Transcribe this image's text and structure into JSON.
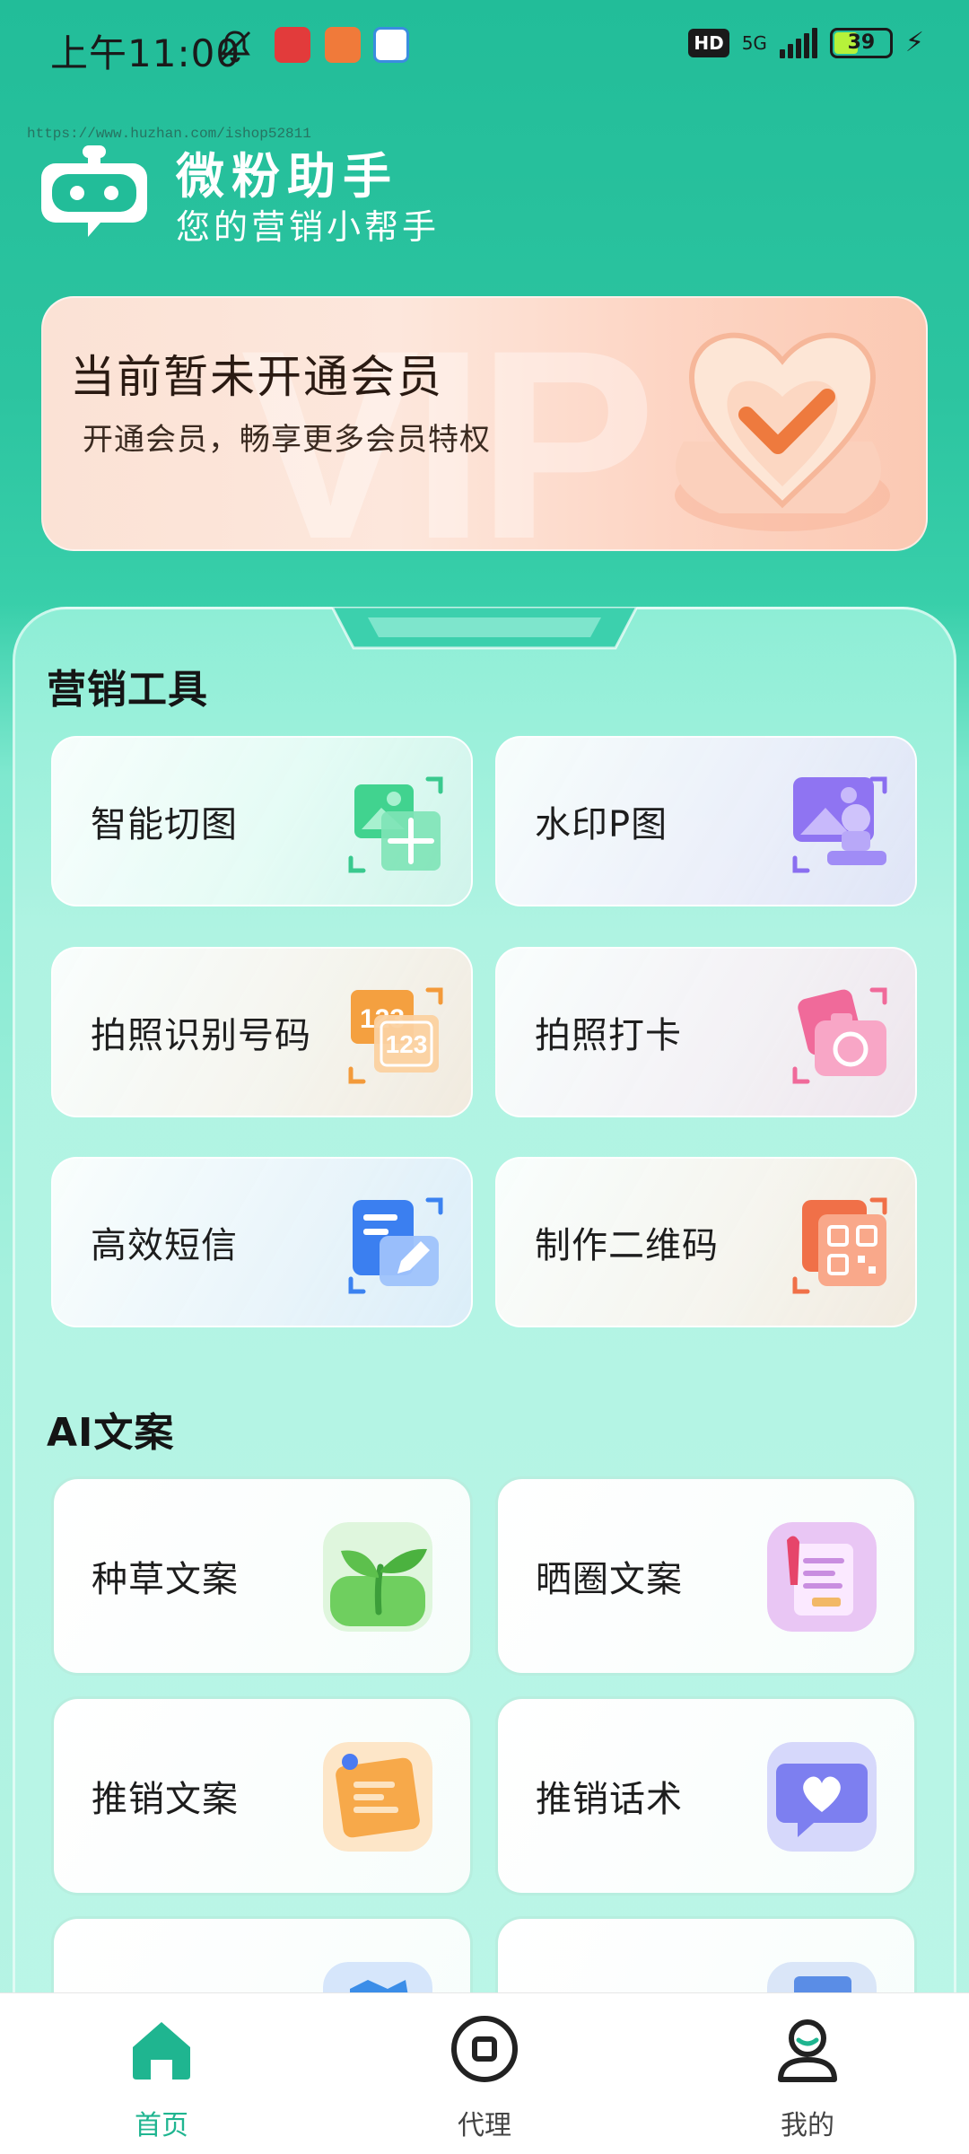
{
  "status_bar": {
    "time": "上午11:00",
    "hd": "HD",
    "network": "5G",
    "battery": "39"
  },
  "header": {
    "watermark": "https://www.huzhan.com/ishop52811",
    "title": "微粉助手",
    "subtitle": "您的营销小帮手"
  },
  "vip_banner": {
    "title": "当前暂未开通会员",
    "desc": "开通会员，畅享更多会员特权",
    "ghost_text": "VIP"
  },
  "marketing_tools": {
    "title": "营销工具",
    "items": [
      {
        "label": "智能切图",
        "icon": "image-crop-icon"
      },
      {
        "label": "水印P图",
        "icon": "watermark-stamp-icon"
      },
      {
        "label": "拍照识别号码",
        "icon": "number-scan-icon"
      },
      {
        "label": "拍照打卡",
        "icon": "camera-checkin-icon"
      },
      {
        "label": "高效短信",
        "icon": "sms-edit-icon"
      },
      {
        "label": "制作二维码",
        "icon": "qr-code-icon"
      }
    ]
  },
  "ai_copy": {
    "title": "AI文案",
    "items": [
      {
        "label": "种草文案",
        "icon": "sprout-icon"
      },
      {
        "label": "晒圈文案",
        "icon": "clipboard-pen-icon"
      },
      {
        "label": "推销文案",
        "icon": "sticky-note-icon"
      },
      {
        "label": "推销话术",
        "icon": "heart-chat-icon"
      },
      {
        "label": "",
        "icon": "badge-icon"
      },
      {
        "label": "",
        "icon": "document-icon"
      }
    ]
  },
  "bottom_nav": {
    "items": [
      {
        "label": "首页",
        "icon": "home-icon",
        "active": true
      },
      {
        "label": "代理",
        "icon": "agent-icon",
        "active": false
      },
      {
        "label": "我的",
        "icon": "profile-icon",
        "active": false
      }
    ]
  },
  "colors": {
    "accent": "#1fb590",
    "header_bg": "#22bd99"
  }
}
